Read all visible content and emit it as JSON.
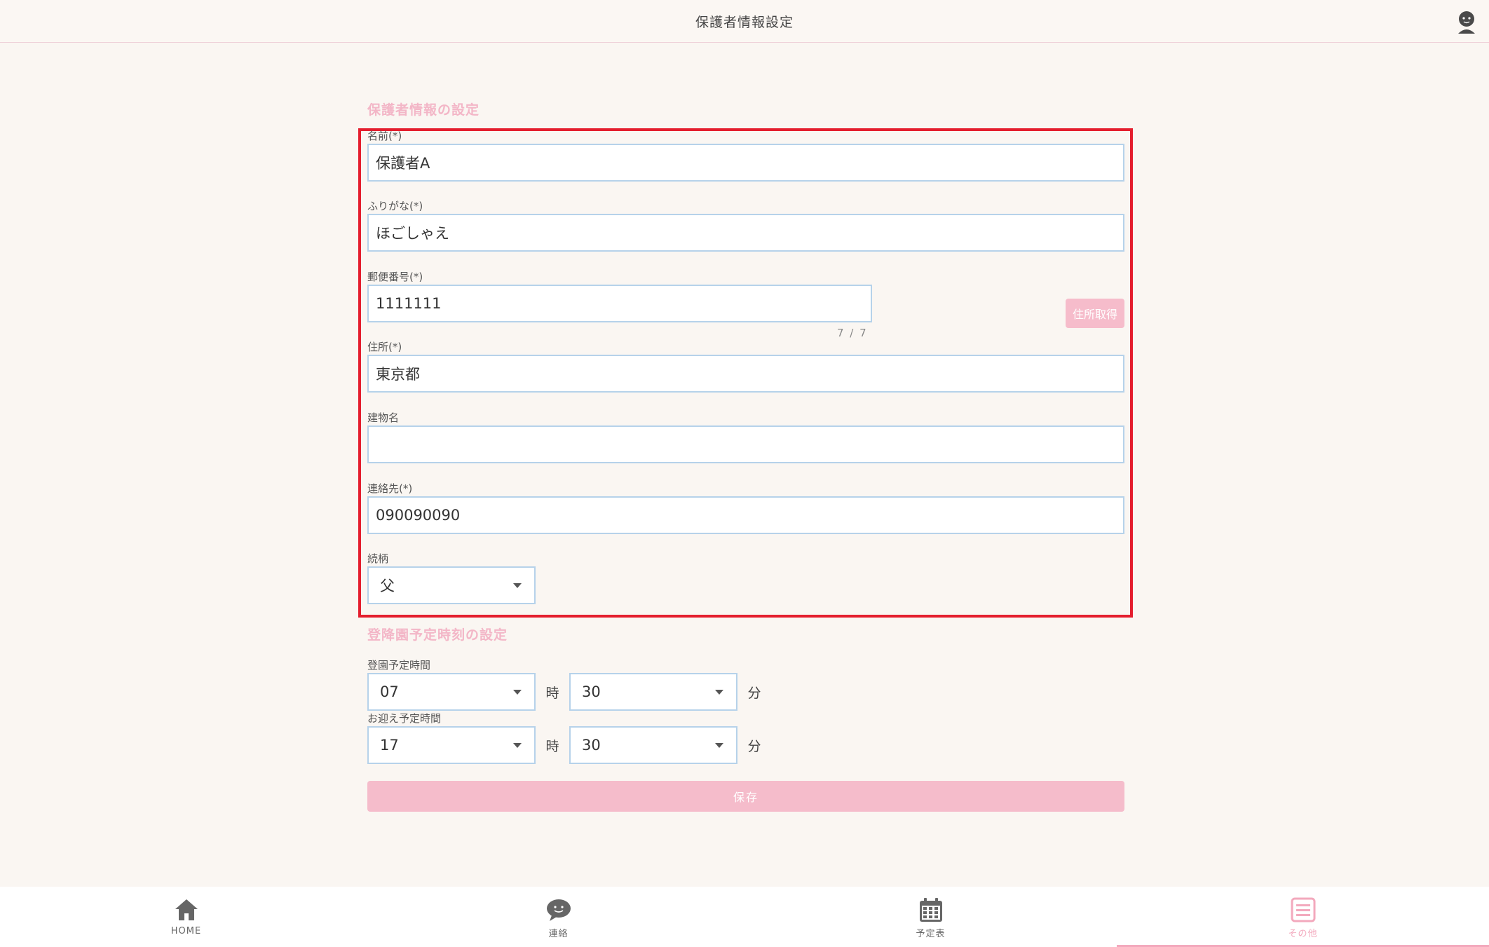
{
  "header": {
    "title": "保護者情報設定"
  },
  "guardian": {
    "section_title": "保護者情報の設定",
    "name": {
      "label": "名前(*)",
      "value": "保護者A"
    },
    "kana": {
      "label": "ふりがな(*)",
      "value": "ほごしゃえ"
    },
    "zip": {
      "label": "郵便番号(*)",
      "value": "1111111",
      "counter": "7 / 7",
      "button": "住所取得"
    },
    "address": {
      "label": "住所(*)",
      "value": "東京都"
    },
    "building": {
      "label": "建物名",
      "value": ""
    },
    "contact": {
      "label": "連絡先(*)",
      "value": "090090090"
    },
    "relation": {
      "label": "続柄",
      "value": "父"
    }
  },
  "schedule": {
    "section_title": "登降園予定時刻の設定",
    "arrival": {
      "label": "登園予定時間",
      "hour": "07",
      "minute": "30"
    },
    "pickup": {
      "label": "お迎え予定時間",
      "hour": "17",
      "minute": "30"
    },
    "hour_unit": "時",
    "minute_unit": "分"
  },
  "save_label": "保存",
  "tabs": [
    {
      "label": "HOME",
      "icon": "home-icon"
    },
    {
      "label": "連絡",
      "icon": "chat-icon"
    },
    {
      "label": "予定表",
      "icon": "calendar-icon"
    },
    {
      "label": "その他",
      "icon": "menu-icon",
      "active": true
    }
  ],
  "colors": {
    "accent_pink": "#f3b6c7",
    "input_border": "#b6d2ea",
    "highlight_red": "#e41e2e",
    "background": "#faf6f2"
  }
}
